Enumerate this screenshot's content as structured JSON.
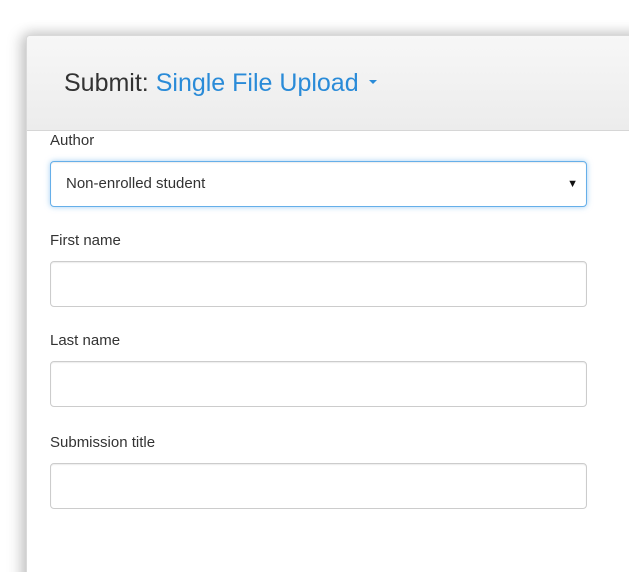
{
  "header": {
    "prefix": "Submit:",
    "submission_type": "Single File Upload",
    "submission_type_icon": "caret-down-icon"
  },
  "form": {
    "author": {
      "label": "Author",
      "selected": "Non-enrolled student",
      "arrow_icon": "dropdown-arrow-icon"
    },
    "first_name": {
      "label": "First name",
      "value": ""
    },
    "last_name": {
      "label": "Last name",
      "value": ""
    },
    "submission_title": {
      "label": "Submission title",
      "value": ""
    }
  },
  "colors": {
    "link": "#2a8bd8",
    "focus_border": "#66afe9",
    "header_bg": "#f2f2f2",
    "text": "#333333"
  }
}
